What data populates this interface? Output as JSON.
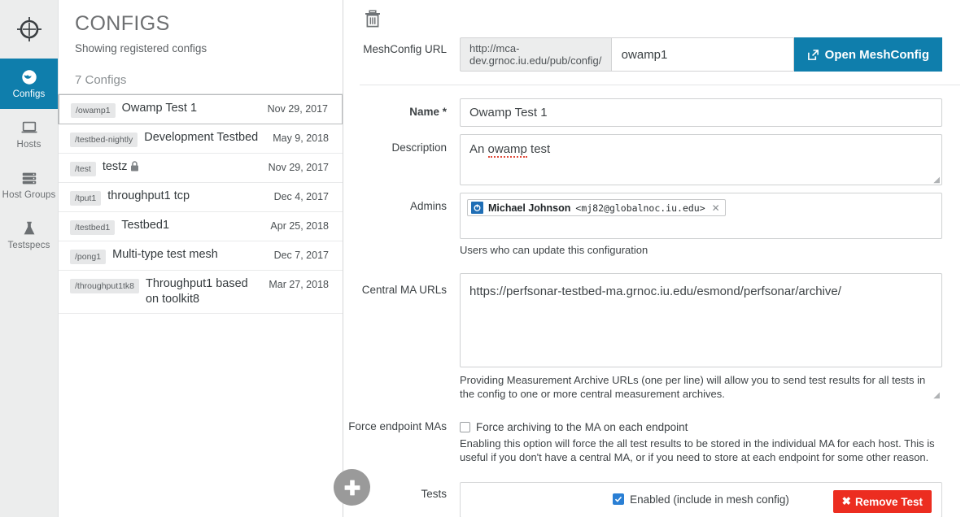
{
  "rail": {
    "logo_icon": "crosshair-target-icon",
    "items": [
      {
        "label": "Configs",
        "icon": "globe-icon",
        "active": true
      },
      {
        "label": "Hosts",
        "icon": "laptop-icon",
        "active": false
      },
      {
        "label": "Host Groups",
        "icon": "server-stack-icon",
        "active": false
      },
      {
        "label": "Testspecs",
        "icon": "flask-icon",
        "active": false
      }
    ],
    "active_color": "#0f7eac"
  },
  "configs_panel": {
    "title": "CONFIGS",
    "subtitle": "Showing registered configs",
    "count_label": "7 Configs",
    "add_button_label": "+",
    "items": [
      {
        "slug": "/owamp1",
        "name": "Owamp Test 1",
        "date": "Nov 29, 2017",
        "locked": false,
        "selected": true
      },
      {
        "slug": "/testbed-nightly",
        "name": "Development Testbed",
        "date": "May 9, 2018",
        "locked": false,
        "selected": false
      },
      {
        "slug": "/test",
        "name": "testz",
        "date": "Nov 29, 2017",
        "locked": true,
        "selected": false
      },
      {
        "slug": "/tput1",
        "name": "throughput1 tcp",
        "date": "Dec 4, 2017",
        "locked": false,
        "selected": false
      },
      {
        "slug": "/testbed1",
        "name": "Testbed1",
        "date": "Apr 25, 2018",
        "locked": false,
        "selected": false
      },
      {
        "slug": "/pong1",
        "name": "Multi-type test mesh",
        "date": "Dec 7, 2017",
        "locked": false,
        "selected": false
      },
      {
        "slug": "/throughput1tk8",
        "name": "Throughput1 based on toolkit8",
        "date": "Mar 27, 2018",
        "locked": false,
        "selected": false
      }
    ]
  },
  "form": {
    "delete_icon": "trash-icon",
    "meshconfig": {
      "label": "MeshConfig URL",
      "prefix": "http://mca-dev.grnoc.iu.edu/pub/config/",
      "value": "owamp1",
      "placeholder": "",
      "button_label": "Open MeshConfig",
      "button_icon": "external-link-icon",
      "button_color": "#0f7eac"
    },
    "name": {
      "label": "Name *",
      "value": "Owamp Test 1",
      "placeholder": ""
    },
    "description": {
      "label": "Description",
      "value_before": "An ",
      "value_misspelled": "owamp",
      "value_after": " test",
      "placeholder": ""
    },
    "admins": {
      "label": "Admins",
      "tag_name": "Michael Johnson",
      "tag_email": "<mj82@globalnoc.iu.edu>",
      "tag_remove_icon": "close-icon",
      "tag_avatar_icon": "power-avatar-icon",
      "help": "Users who can update this configuration"
    },
    "central_ma": {
      "label": "Central MA URLs",
      "value": "https://perfsonar-testbed-ma.grnoc.iu.edu/esmond/perfsonar/archive/",
      "placeholder": "",
      "help": "Providing Measurement Archive URLs (one per line) will allow you to send test results for all tests in the config to one or more central measurement archives."
    },
    "force_endpoint": {
      "label": "Force endpoint MAs",
      "checkbox_label": "Force archiving to the MA on each endpoint",
      "checked": false,
      "help": "Enabling this option will force the all test results to be stored in the individual MA for each host. This is useful if you don't have a central MA, or if you need to store at each endpoint for some other reason."
    },
    "tests": {
      "label": "Tests",
      "enabled_label": "Enabled (include in mesh config)",
      "enabled_checked": true,
      "remove_label": "Remove Test",
      "remove_icon": "x-icon",
      "remove_color": "#ec2d20"
    }
  }
}
